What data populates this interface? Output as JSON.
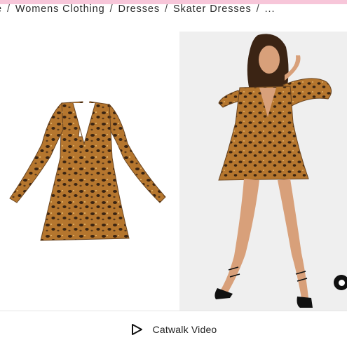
{
  "breadcrumb": {
    "items": [
      "e",
      "Womens Clothing",
      "Dresses",
      "Skater Dresses",
      "..."
    ],
    "separator": "/"
  },
  "gallery": {
    "images": [
      {
        "name": "product-flatlay-image",
        "alt": ""
      },
      {
        "name": "model-image",
        "alt": ""
      }
    ]
  },
  "catwalk": {
    "label": "Catwalk Video",
    "icon": "play-icon"
  },
  "colors": {
    "top_strip": "#f7c6d9",
    "text": "#222222",
    "leopard_base": "#b5762e",
    "leopard_spot": "#3a2412"
  }
}
